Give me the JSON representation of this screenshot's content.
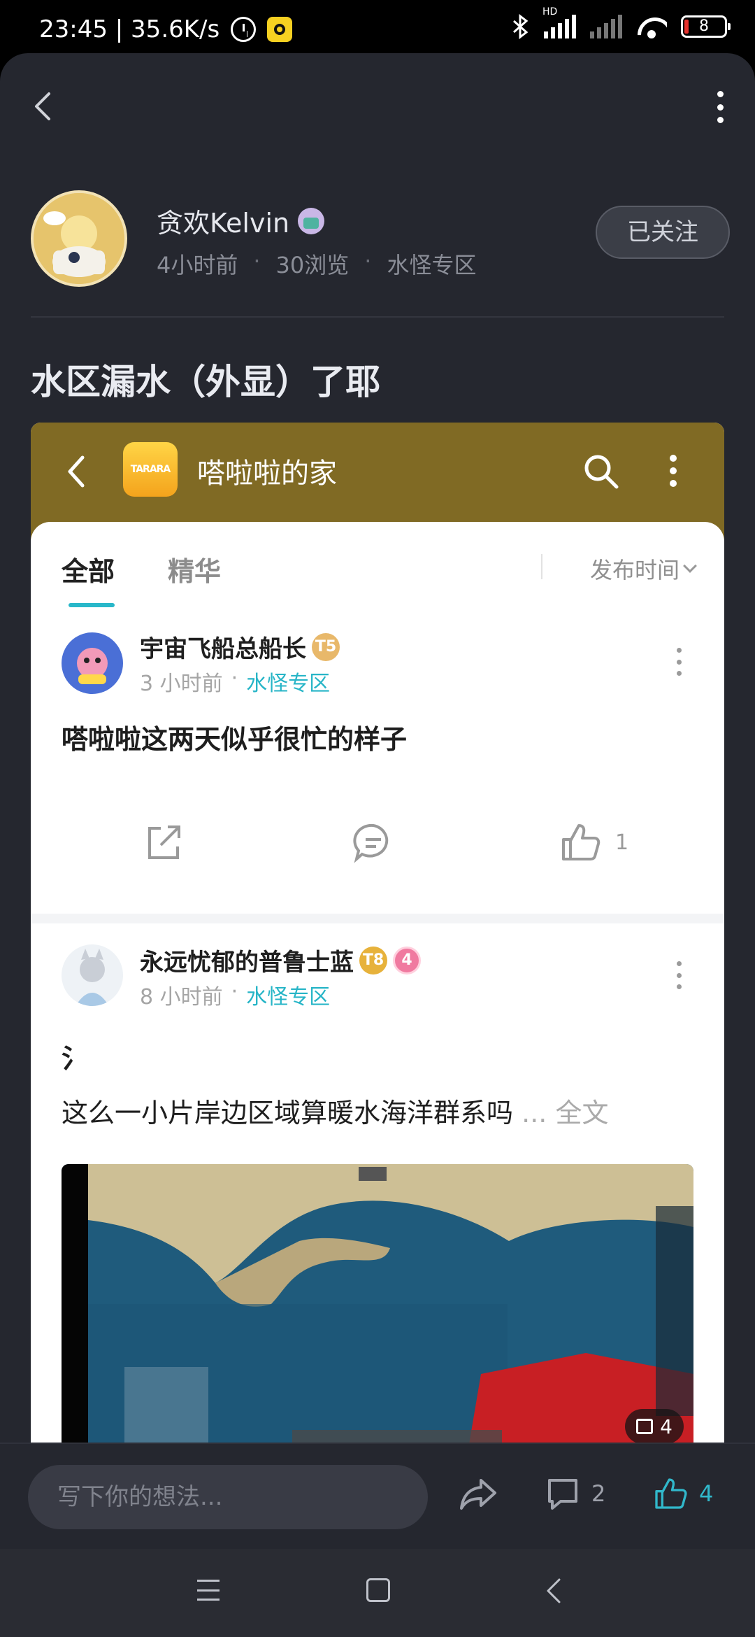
{
  "status_bar": {
    "time_speed": "23:45 | 35.6K/s",
    "network": "HD",
    "battery": "8"
  },
  "post": {
    "author": {
      "name": "贪欢Kelvin",
      "time": "4小时前",
      "views": "30浏览",
      "zone": "水怪专区"
    },
    "follow_label": "已关注",
    "title": "水区漏水（外显）了耶"
  },
  "embedded": {
    "header_title": "嗒啦啦的家",
    "logo_text": "TARARA",
    "tabs": [
      "全部",
      "精华"
    ],
    "sort_label": "发布时间",
    "cards": [
      {
        "name": "宇宙飞船总船长",
        "level": "T5",
        "time": "3 小时前",
        "zone": "水怪专区",
        "text": "嗒啦啦这两天似乎很忙的样子",
        "like_count": "1"
      },
      {
        "name": "永远忧郁的普鲁士蓝",
        "level": "T8",
        "badge": "4",
        "time": "8 小时前",
        "zone": "水怪专区",
        "heading": "氵",
        "text": "这么一小片岸边区域算暖水海洋群系吗",
        "ellipsis": "...",
        "more_label": "全文",
        "image_count": "4"
      }
    ]
  },
  "bottom_bar": {
    "comment_placeholder": "写下你的想法...",
    "comment_count": "2",
    "like_count": "4"
  },
  "colors": {
    "background": "#25272f",
    "accent": "#31b8cb",
    "embedded_header": "#806a24"
  }
}
